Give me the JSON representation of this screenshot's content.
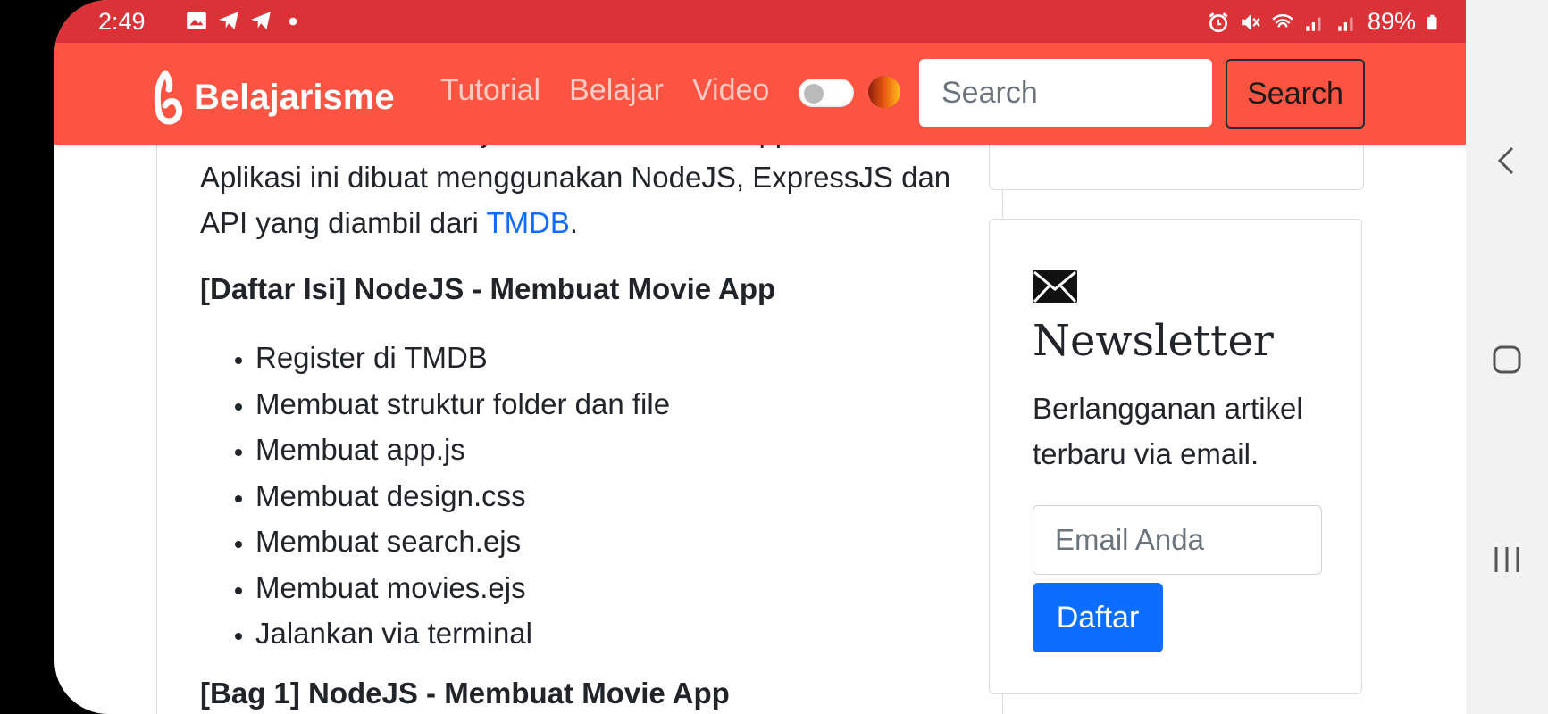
{
  "status_bar": {
    "time": "2:49",
    "battery": "89%",
    "left_icons": [
      "image-icon",
      "telegram-icon",
      "telegram-icon",
      "dot-icon"
    ],
    "right_icons": [
      "alarm-icon",
      "mute-icon",
      "wifi-icon",
      "signal-icon",
      "signal-icon",
      "battery-icon"
    ]
  },
  "navbar": {
    "brand": "Belajarisme",
    "links": [
      "Tutorial",
      "Belajar",
      "Video"
    ],
    "search_placeholder": "Search",
    "search_button": "Search",
    "bg_color": "#fc5442"
  },
  "article": {
    "partial_line": "Hari ini kita akan belajar membuat Movie App.",
    "intro_before_link": "Aplikasi ini dibuat menggunakan NodeJS, ExpressJS dan API yang diambil dari ",
    "intro_link": "TMDB",
    "intro_after_link": ".",
    "toc_title": "[Daftar Isi] NodeJS - Membuat Movie App",
    "toc_items": [
      "Register di TMDB",
      "Membuat struktur folder dan file",
      "Membuat app.js",
      "Membuat design.css",
      "Membuat search.ejs",
      "Membuat movies.ejs",
      "Jalankan via terminal"
    ],
    "next_heading_partial": "[Bag 1] NodeJS - Membuat Movie App"
  },
  "newsletter": {
    "title": "Newsletter",
    "description": "Berlangganan artikel terbaru via email.",
    "email_placeholder": "Email Anda",
    "button": "Daftar",
    "button_color": "#0d6efd"
  }
}
